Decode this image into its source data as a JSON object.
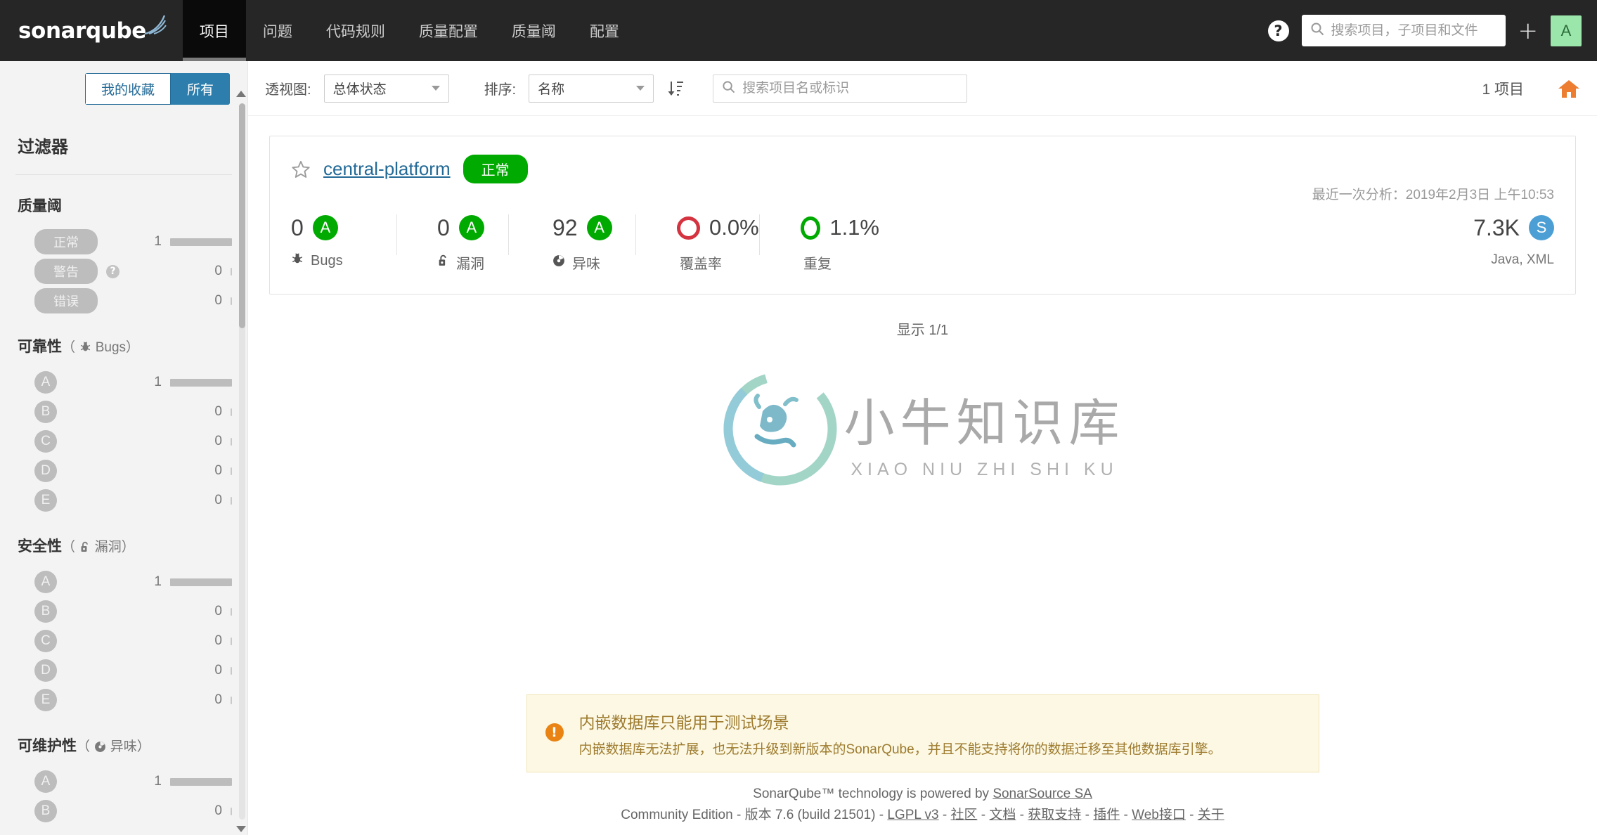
{
  "topnav": {
    "logo": "sonarqube",
    "items": [
      {
        "label": "项目",
        "active": true
      },
      {
        "label": "问题",
        "active": false
      },
      {
        "label": "代码规则",
        "active": false
      },
      {
        "label": "质量配置",
        "active": false
      },
      {
        "label": "质量阈",
        "active": false
      },
      {
        "label": "配置",
        "active": false
      }
    ],
    "help_label": "?",
    "search_placeholder": "搜索项目，子项目和文件",
    "search_value": "",
    "plus_label": "+",
    "avatar_label": "A",
    "avatar_color": "#9be7ab"
  },
  "sidebar": {
    "toggle": {
      "favorites": "我的收藏",
      "all": "所有",
      "active": "all"
    },
    "filters_title": "过滤器",
    "facets": [
      {
        "id": "quality-gate",
        "title": "质量阈",
        "sub": "",
        "icon": "",
        "type": "pill",
        "rows": [
          {
            "label": "正常",
            "count": "1",
            "bar": 88,
            "help": false
          },
          {
            "label": "警告",
            "count": "0",
            "bar": 0,
            "help": true
          },
          {
            "label": "错误",
            "count": "0",
            "bar": 0,
            "help": false
          }
        ]
      },
      {
        "id": "reliability",
        "title": "可靠性",
        "sub": "Bugs",
        "icon": "bug-icon",
        "type": "rating",
        "rows": [
          {
            "label": "A",
            "count": "1",
            "bar": 88
          },
          {
            "label": "B",
            "count": "0",
            "bar": 0
          },
          {
            "label": "C",
            "count": "0",
            "bar": 0
          },
          {
            "label": "D",
            "count": "0",
            "bar": 0
          },
          {
            "label": "E",
            "count": "0",
            "bar": 0
          }
        ]
      },
      {
        "id": "security",
        "title": "安全性",
        "sub": "漏洞",
        "icon": "vulnerability-icon",
        "type": "rating",
        "rows": [
          {
            "label": "A",
            "count": "1",
            "bar": 88
          },
          {
            "label": "B",
            "count": "0",
            "bar": 0
          },
          {
            "label": "C",
            "count": "0",
            "bar": 0
          },
          {
            "label": "D",
            "count": "0",
            "bar": 0
          },
          {
            "label": "E",
            "count": "0",
            "bar": 0
          }
        ]
      },
      {
        "id": "maintainability",
        "title": "可维护性",
        "sub": "异味",
        "icon": "code-smell-icon",
        "type": "rating",
        "rows": [
          {
            "label": "A",
            "count": "1",
            "bar": 88
          },
          {
            "label": "B",
            "count": "0",
            "bar": 0
          }
        ]
      }
    ]
  },
  "toolbar": {
    "perspective_label": "透视图:",
    "perspective_value": "总体状态",
    "sort_label": "排序:",
    "sort_value": "名称",
    "search_placeholder": "搜索项目名或标识",
    "search_value": "",
    "project_count": "1 项目"
  },
  "project": {
    "name": "central-platform",
    "status": "正常",
    "status_color": "#00aa00",
    "analysis_date": "最近一次分析：2019年2月3日 上午10:53",
    "metrics": [
      {
        "id": "bugs",
        "value": "0",
        "rating": "A",
        "rating_color": "#00aa00",
        "label": "Bugs",
        "icon": "bug-icon"
      },
      {
        "id": "vulnerabilities",
        "value": "0",
        "rating": "A",
        "rating_color": "#00aa00",
        "label": "漏洞",
        "icon": "vulnerability-icon"
      },
      {
        "id": "code-smells",
        "value": "92",
        "rating": "A",
        "rating_color": "#00aa00",
        "label": "异味",
        "icon": "code-smell-icon"
      }
    ],
    "coverage": {
      "value": "0.0%",
      "label": "覆盖率",
      "color": "#d4333f"
    },
    "duplications": {
      "value": "1.1%",
      "label": "重复",
      "color": "#00aa00"
    },
    "size": {
      "value": "7.3K",
      "rating": "S",
      "rating_color": "#4b9fd5",
      "languages": "Java, XML"
    }
  },
  "showing": "显示 1/1",
  "watermark": {
    "cn": "小牛知识库",
    "en": "XIAO NIU ZHI SHI KU"
  },
  "warning": {
    "title": "内嵌数据库只能用于测试场景",
    "body": "内嵌数据库无法扩展，也无法升级到新版本的SonarQube，并且不能支持将你的数据迁移至其他数据库引擎。"
  },
  "footer": {
    "line1_prefix": "SonarQube™ technology is powered by ",
    "line1_link": "SonarSource SA",
    "edition": "Community Edition",
    "version": "版本 7.6 (build 21501)",
    "links": [
      "LGPL v3",
      "社区",
      "文档",
      "获取支持",
      "插件",
      "Web接口",
      "关于"
    ],
    "separator": " - "
  }
}
